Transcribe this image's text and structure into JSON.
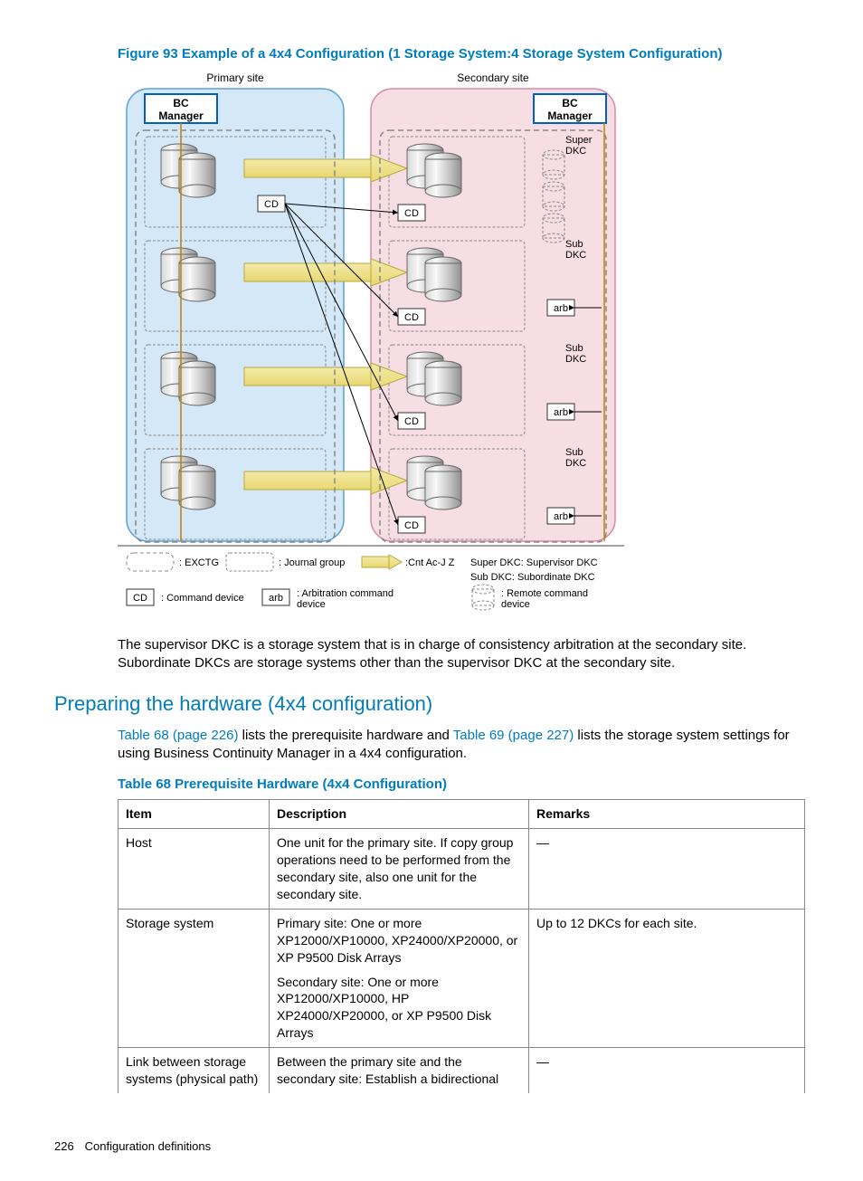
{
  "figure": {
    "caption": "Figure 93 Example of a 4x4 Configuration (1 Storage System:4 Storage System Configuration)",
    "primary_site_label": "Primary site",
    "secondary_site_label": "Secondary site",
    "bc_manager_label_1": "BC",
    "bc_manager_label_2": "Manager",
    "cd_label": "CD",
    "arb_label": "arb",
    "super_dkc_label_1": "Super",
    "super_dkc_label_2": "DKC",
    "sub_dkc_label_1": "Sub",
    "sub_dkc_label_2": "DKC",
    "legend": {
      "exctg": ": EXCTG",
      "journal_group": ": Journal group",
      "cnt_ac": ":Cnt Ac-J Z",
      "super_dkc_def": "Super DKC: Supervisor DKC",
      "sub_dkc_def": "Sub DKC: Subordinate DKC",
      "command_device": ": Command device",
      "arb_device_1": ": Arbitration command",
      "arb_device_2": "device",
      "remote_cmd_1": ": Remote command",
      "remote_cmd_2": "device"
    }
  },
  "para_after_figure": "The supervisor DKC is a storage system that is in charge of consistency arbitration at the secondary site. Subordinate DKCs are storage systems other than the supervisor DKC at the secondary site.",
  "section_heading": "Preparing the hardware (4x4 configuration)",
  "para_section_pre": "",
  "para_section_link1": "Table 68 (page 226)",
  "para_section_mid": " lists the prerequisite hardware and ",
  "para_section_link2": "Table 69 (page 227)",
  "para_section_post": " lists the storage system settings for using Business Continuity Manager in a 4x4 configuration.",
  "table_caption": "Table 68 Prerequisite Hardware (4x4 Configuration)",
  "table": {
    "headers": {
      "item": "Item",
      "description": "Description",
      "remarks": "Remarks"
    },
    "rows": [
      {
        "item": "Host",
        "description": "One unit for the primary site. If copy group operations need to be performed from the secondary site, also one unit for the secondary site.",
        "remarks": "—"
      },
      {
        "item": "Storage system",
        "description_p1": "Primary site: One or more XP12000/XP10000, XP24000/XP20000, or XP P9500 Disk Arrays",
        "description_p2": "Secondary site: One or more XP12000/XP10000, HP XP24000/XP20000, or XP P9500 Disk Arrays",
        "remarks": "Up to 12 DKCs for each site."
      },
      {
        "item": "Link between storage systems (physical path)",
        "description": "Between the primary site and the secondary site: Establish a bidirectional",
        "remarks": "—"
      }
    ]
  },
  "footer": {
    "page_num": "226",
    "chapter": "Configuration definitions"
  }
}
